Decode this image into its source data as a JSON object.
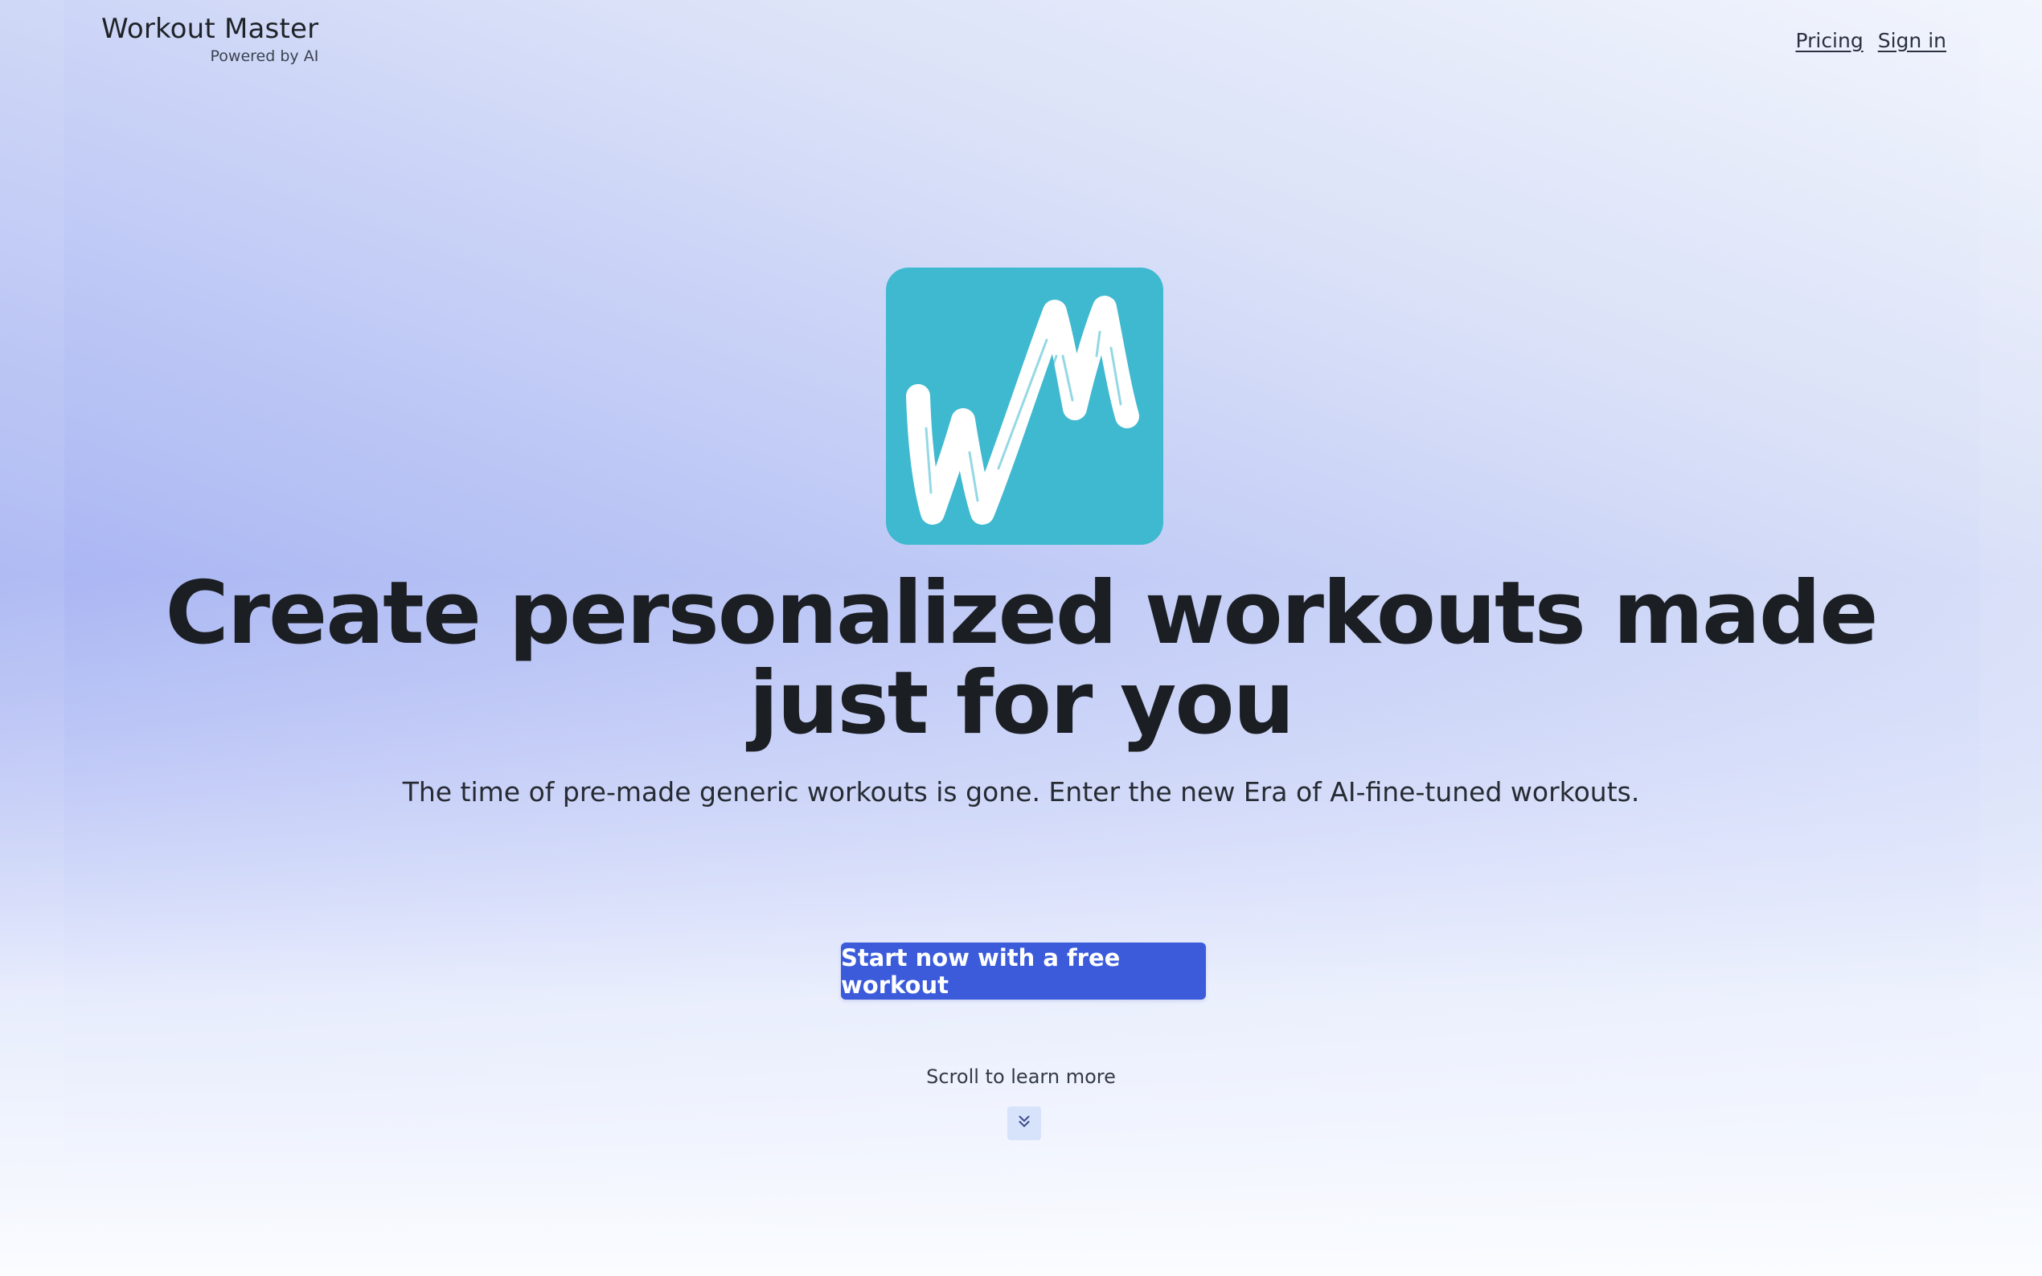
{
  "header": {
    "brand_title": "Workout Master",
    "brand_subtitle": "Powered by AI",
    "nav": [
      {
        "label": "Pricing"
      },
      {
        "label": "Sign in"
      }
    ]
  },
  "hero": {
    "logo_icon": "wm-logo-icon",
    "logo_color": "#3fb9cf",
    "headline": "Create personalized workouts made just for you",
    "subtitle": "The time of pre-made generic workouts is gone. Enter the new Era of AI-fine-tuned workouts.",
    "cta_label": "Start now with a free workout",
    "cta_color": "#3b5bdb",
    "scroll_hint": "Scroll to learn more",
    "scroll_icon": "chevrons-down-icon"
  }
}
